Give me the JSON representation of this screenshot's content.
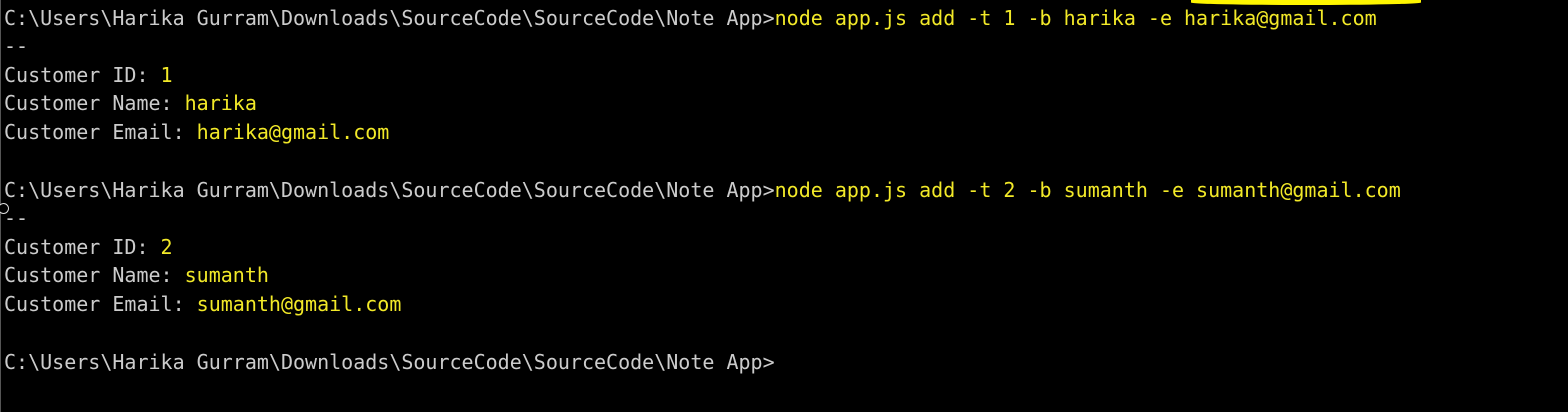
{
  "terminal": {
    "prompt": "C:\\Users\\Harika Gurram\\Downloads\\SourceCode\\SourceCode\\Note App>",
    "colors": {
      "background": "#000000",
      "text": "#cccccc",
      "highlight": "#f2e928"
    },
    "entries": [
      {
        "command": "node app.js add -t 1 -b harika -e harika@gmail.com",
        "separator": "--",
        "id_label": "Customer ID: ",
        "id_value": "1",
        "name_label": "Customer Name: ",
        "name_value": "harika",
        "email_label": "Customer Email: ",
        "email_value": "harika@gmail.com"
      },
      {
        "command": "node app.js add -t 2 -b sumanth -e sumanth@gmail.com",
        "separator": "--",
        "id_label": "Customer ID: ",
        "id_value": "2",
        "name_label": "Customer Name: ",
        "name_value": "sumanth",
        "email_label": "Customer Email: ",
        "email_value": "sumanth@gmail.com"
      }
    ]
  }
}
